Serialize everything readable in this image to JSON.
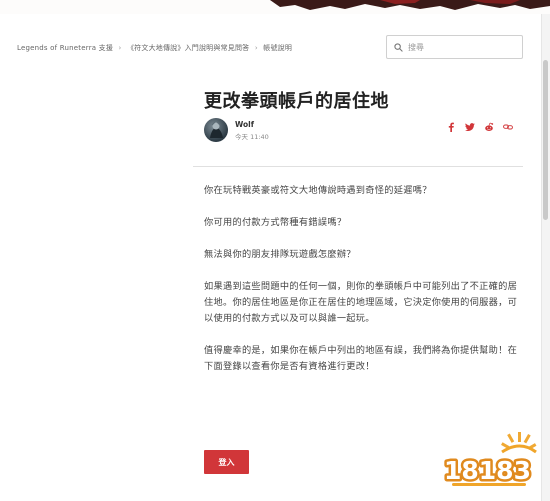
{
  "breadcrumb": {
    "items": [
      "Legends of Runeterra 支援",
      "《符文大地傳說》入門說明與常見問答",
      "帳號說明"
    ],
    "separator": "›"
  },
  "search": {
    "placeholder": "搜尋",
    "icon": "search-icon"
  },
  "article": {
    "title": "更改拳頭帳戶的居住地",
    "author": "Wolf",
    "time": "今天 11:40",
    "share_icons": [
      "facebook-icon",
      "twitter-icon",
      "reddit-icon",
      "link-icon"
    ],
    "paragraphs": [
      "你在玩特戰英豪或符文大地傳說時遇到奇怪的延遲嗎？",
      "你可用的付款方式幣種有錯誤嗎？",
      "無法與你的朋友排隊玩遊戲怎麼辦？",
      "如果遇到這些問題中的任何一個，則你的拳頭帳戶中可能列出了不正確的居住地。你的居住地區是你正在居住的地理區域，它決定你使用的伺服器，可以使用的付款方式以及可以與誰一起玩。",
      "值得慶幸的是，如果你在帳戶中列出的地區有誤，我們將為你提供幫助！在下面登錄以查看你是否有資格進行更改！"
    ]
  },
  "login_button": {
    "label": "登入"
  },
  "watermark": {
    "text": "18183"
  },
  "colors": {
    "accent": "#d13639",
    "share": "#d13639",
    "title": "#222222",
    "body": "#444444"
  }
}
